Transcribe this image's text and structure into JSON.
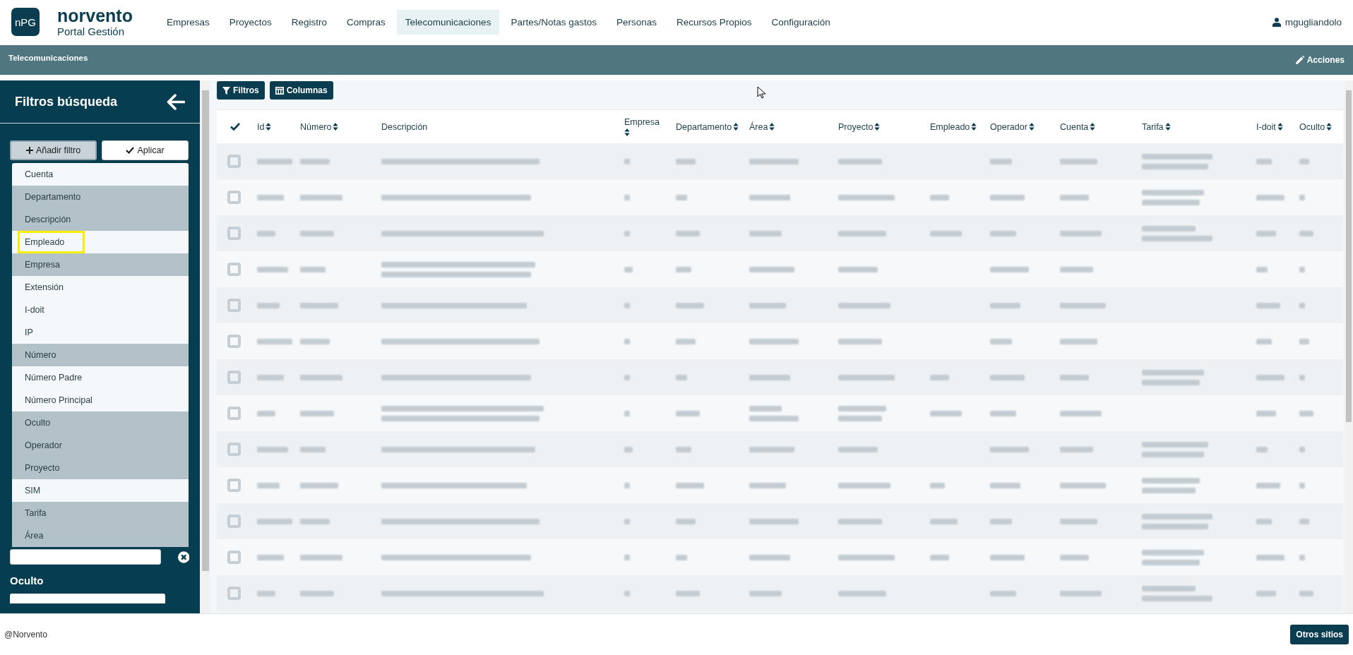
{
  "logo": {
    "badge": "nPG",
    "name": "norvento",
    "subtitle": "Portal Gestión"
  },
  "nav": [
    {
      "label": "Empresas",
      "selected": false
    },
    {
      "label": "Proyectos",
      "selected": false
    },
    {
      "label": "Registro",
      "selected": false
    },
    {
      "label": "Compras",
      "selected": false
    },
    {
      "label": "Telecomunicaciones",
      "selected": true
    },
    {
      "label": "Partes/Notas gastos",
      "selected": false
    },
    {
      "label": "Personas",
      "selected": false
    },
    {
      "label": "Recursos Propios",
      "selected": false
    },
    {
      "label": "Configuración",
      "selected": false
    }
  ],
  "user": "mgugliandolo",
  "page_bar": {
    "title": "Telecomunicaciones",
    "action": "Acciones"
  },
  "sidebar": {
    "title": "Filtros búsqueda",
    "add_button": "Añadir filtro",
    "apply_button": "Aplicar",
    "dropdown": [
      {
        "label": "Cuenta",
        "added": false,
        "highlighted": false
      },
      {
        "label": "Departamento",
        "added": true,
        "highlighted": false
      },
      {
        "label": "Descripción",
        "added": true,
        "highlighted": false
      },
      {
        "label": "Empleado",
        "added": false,
        "highlighted": true
      },
      {
        "label": "Empresa",
        "added": true,
        "highlighted": false
      },
      {
        "label": "Extensión",
        "added": false,
        "highlighted": false
      },
      {
        "label": "I-doit",
        "added": false,
        "highlighted": false
      },
      {
        "label": "IP",
        "added": false,
        "highlighted": false
      },
      {
        "label": "Número",
        "added": true,
        "highlighted": false
      },
      {
        "label": "Número Padre",
        "added": false,
        "highlighted": false
      },
      {
        "label": "Número Principal",
        "added": false,
        "highlighted": false
      },
      {
        "label": "Oculto",
        "added": true,
        "highlighted": false
      },
      {
        "label": "Operador",
        "added": true,
        "highlighted": false
      },
      {
        "label": "Proyecto",
        "added": true,
        "highlighted": false
      },
      {
        "label": "SIM",
        "added": false,
        "highlighted": false
      },
      {
        "label": "Tarifa",
        "added": true,
        "highlighted": false
      },
      {
        "label": "Área",
        "added": true,
        "highlighted": false
      }
    ],
    "next_filter_label": "Oculto"
  },
  "toolbar": {
    "filters_button": "Filtros",
    "columns_button": "Columnas"
  },
  "table": {
    "columns": [
      {
        "label": "Id",
        "sortable": true
      },
      {
        "label": "Número",
        "sortable": true
      },
      {
        "label": "Descripción",
        "sortable": false
      },
      {
        "label": "Empresa",
        "sortable": true
      },
      {
        "label": "Departamento",
        "sortable": true
      },
      {
        "label": "Área",
        "sortable": true
      },
      {
        "label": "Proyecto",
        "sortable": true
      },
      {
        "label": "Empleado",
        "sortable": true
      },
      {
        "label": "Operador",
        "sortable": true
      },
      {
        "label": "Cuenta",
        "sortable": true
      },
      {
        "label": "Tarifa",
        "sortable": true
      },
      {
        "label": "I-doit",
        "sortable": true
      },
      {
        "label": "Oculto",
        "sortable": true
      }
    ],
    "rows": [
      {
        "selected": false
      },
      {
        "selected": false
      },
      {
        "selected": false
      },
      {
        "selected": false
      },
      {
        "selected": false
      },
      {
        "selected": false
      },
      {
        "selected": false
      },
      {
        "selected": false
      },
      {
        "selected": false
      },
      {
        "selected": false
      },
      {
        "selected": false
      },
      {
        "selected": false
      },
      {
        "selected": false
      }
    ]
  },
  "footer": {
    "copyright": "@Norvento",
    "button": "Otros sitios"
  }
}
